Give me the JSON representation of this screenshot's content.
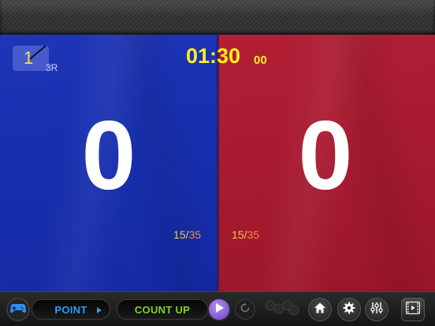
{
  "round": {
    "current": "1",
    "total": "3R"
  },
  "timer": {
    "main": "01:30",
    "sub": "00"
  },
  "scores": {
    "blue": {
      "score": "0",
      "current": "15",
      "separator": "/",
      "max": "35"
    },
    "red": {
      "score": "0",
      "current": "15",
      "separator": "/",
      "max": "35"
    }
  },
  "colors": {
    "blue_panel": "#1a30ae",
    "red_panel": "#a71a30",
    "timer": "#ffee22",
    "point_label": "#2b9df0",
    "count_label": "#7ed321",
    "play": "#7a4ad0"
  },
  "toolbar": {
    "mode_label": "POINT",
    "timer_mode_label": "COUNT UP",
    "icons": [
      "gamepad-icon",
      "chevron-right-icon",
      "play-icon",
      "reset-icon",
      "dots-icon",
      "home-icon",
      "gear-icon",
      "mixer-icon",
      "film-icon"
    ]
  }
}
